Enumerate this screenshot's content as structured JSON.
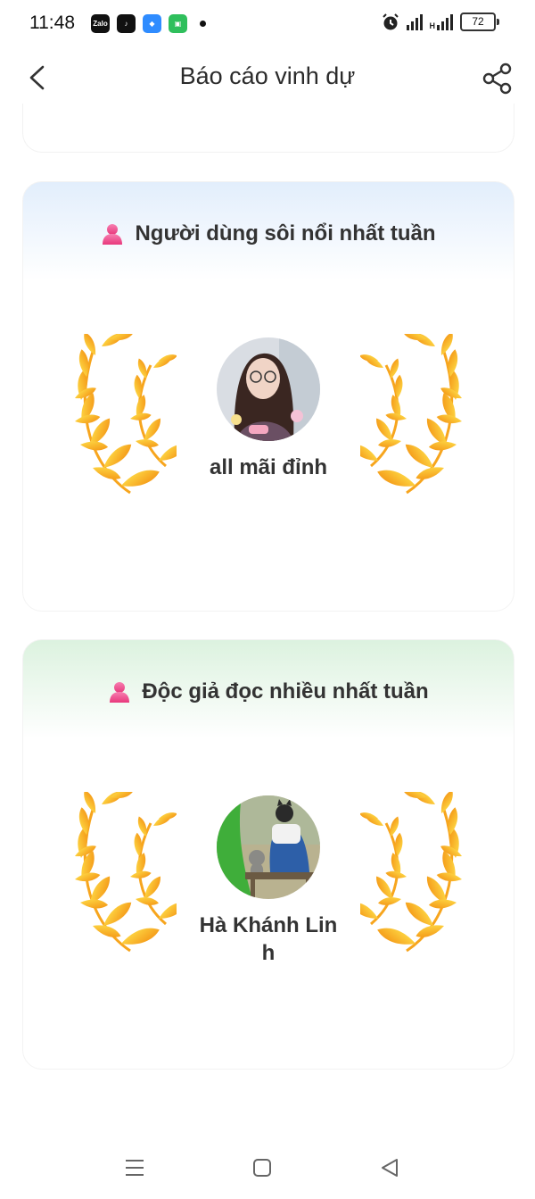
{
  "status": {
    "time": "11:48",
    "battery": "72",
    "app_icons": [
      "zalo-icon",
      "tiktok-icon",
      "blue-app-icon",
      "green-app-icon"
    ],
    "network": "H"
  },
  "header": {
    "title": "Báo cáo vinh dự"
  },
  "cards": [
    {
      "title": "Người dùng sôi nổi nhất tuần",
      "name": "all mãi đỉnh",
      "accent": "#e2eefc"
    },
    {
      "title": "Độc giả đọc nhiều nhất tuần",
      "name_line1": "Hà Khánh Lin",
      "name_line2": "h",
      "accent": "#dcf2df"
    }
  ],
  "colors": {
    "laurel_light": "#ffd23a",
    "laurel_dark": "#f49a12",
    "icon_pink": "#f0508e"
  }
}
